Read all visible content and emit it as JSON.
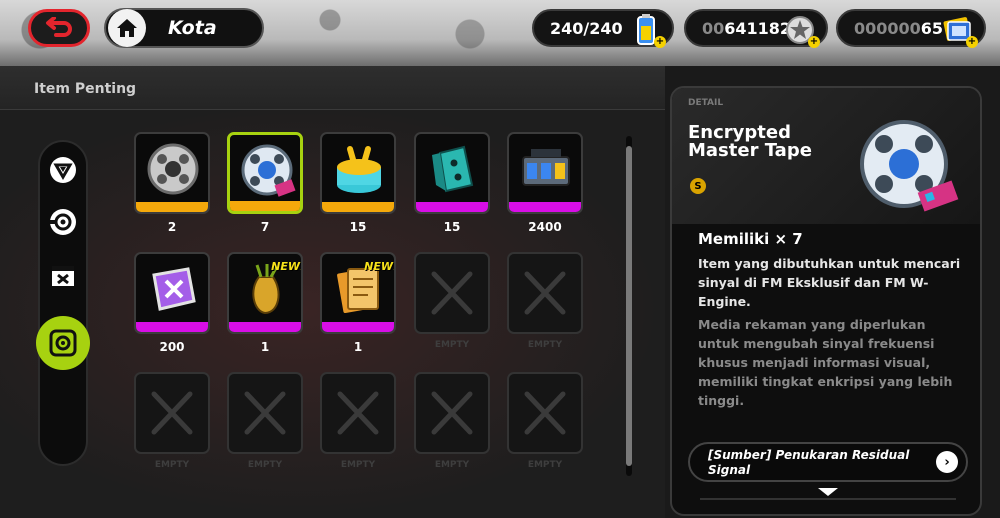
{
  "topbar": {
    "location": "Kota",
    "battery": "240/240",
    "polychrome_dim": "00",
    "polychrome_value": "641182",
    "ticket_dim": "000000",
    "ticket_value": "65"
  },
  "left": {
    "section_title": "Item Penting"
  },
  "items": [
    {
      "name": "film-reel-silver",
      "count": "2",
      "rarity": "gold"
    },
    {
      "name": "encrypted-master-tape",
      "count": "7",
      "rarity": "gold",
      "selected": true
    },
    {
      "name": "bangboo-cake",
      "count": "15",
      "rarity": "gold"
    },
    {
      "name": "dice-cube",
      "count": "15",
      "rarity": "purple"
    },
    {
      "name": "battery-pack",
      "count": "2400",
      "rarity": "purple"
    },
    {
      "name": "purple-crystal-block",
      "count": "200",
      "rarity": "purple"
    },
    {
      "name": "golden-carrot",
      "count": "1",
      "rarity": "purple",
      "badge": "NEW!"
    },
    {
      "name": "paper-tickets",
      "count": "1",
      "rarity": "purple",
      "badge": "NEW!"
    }
  ],
  "empty_label": "EMPTY",
  "detail": {
    "tag": "DETAIL",
    "title": "Encrypted Master Tape",
    "rank": "S",
    "owned": "Memiliki × 7",
    "description": "Item yang dibutuhkan untuk mencari sinyal di FM Eksklusif dan FM W-Engine.",
    "lore": "Media rekaman yang diperlukan untuk mengubah sinyal frekuensi khusus menjadi informasi visual, memiliki tingkat enkripsi yang lebih tinggi.",
    "source": "[Sumber] Penukaran Residual Signal"
  },
  "colors": {
    "accent_green": "#a7d210",
    "rarity_gold": "#f5a90b",
    "rarity_purple": "#d80ee6",
    "back_red": "#e3252d"
  }
}
